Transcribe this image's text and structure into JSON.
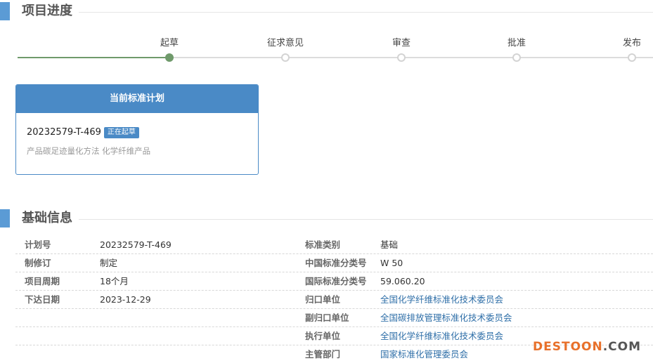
{
  "progress_section": {
    "title": "项目进度",
    "steps": [
      {
        "label": "起草",
        "active": true
      },
      {
        "label": "征求意见",
        "active": false
      },
      {
        "label": "审查",
        "active": false
      },
      {
        "label": "批准",
        "active": false
      },
      {
        "label": "发布",
        "active": false
      }
    ]
  },
  "plan_card": {
    "header": "当前标准计划",
    "plan_code": "20232579-T-469",
    "status_badge": "正在起草",
    "description": "产品碳足迹量化方法 化学纤维产品"
  },
  "info_section": {
    "title": "基础信息",
    "rows": [
      {
        "left_key": "计划号",
        "left_value": "20232579-T-469",
        "right_key": "标准类别",
        "right_value": "基础"
      },
      {
        "left_key": "制修订",
        "left_value": "制定",
        "right_key": "中国标准分类号",
        "right_value": "W 50"
      },
      {
        "left_key": "项目周期",
        "left_value": "18个月",
        "right_key": "国际标准分类号",
        "right_value": "59.060.20"
      },
      {
        "left_key": "下达日期",
        "left_value": "2023-12-29",
        "right_key": "归口单位",
        "right_value": "全国化学纤维标准化技术委员会"
      },
      {
        "left_key": "",
        "left_value": "",
        "right_key": "副归口单位",
        "right_value": "全国碳排放管理标准化技术委员会"
      },
      {
        "left_key": "",
        "left_value": "",
        "right_key": "执行单位",
        "right_value": "全国化学纤维标准化技术委员会"
      },
      {
        "left_key": "",
        "left_value": "",
        "right_key": "主管部门",
        "right_value": "国家标准化管理委员会"
      }
    ]
  },
  "watermark": {
    "brand": "DESTOON",
    "tld": ".COM"
  },
  "colors": {
    "accent": "#4a8ac6",
    "progress_done": "#6f9a6b",
    "link": "#2f6fa8"
  }
}
